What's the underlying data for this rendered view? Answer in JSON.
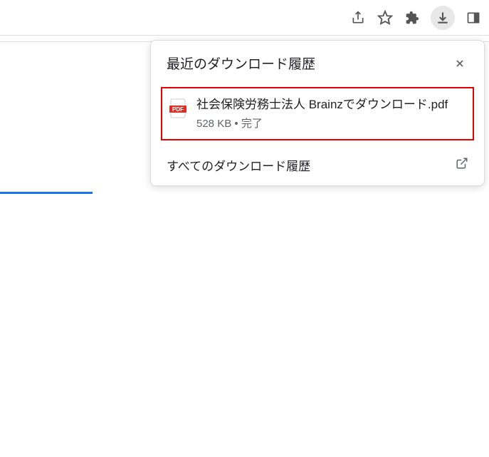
{
  "toolbar": {
    "icons": {
      "share": "share-icon",
      "star": "star-icon",
      "extensions": "puzzle-icon",
      "downloads": "download-icon",
      "panel": "sidepanel-icon"
    }
  },
  "dropdown": {
    "title": "最近のダウンロード履歴",
    "close_label": "閉じる",
    "item": {
      "filename": "社会保険労務士法人 Brainzでダウンロード.pdf",
      "size": "528 KB",
      "separator": " • ",
      "status": "完了"
    },
    "all_downloads_label": "すべてのダウンロード履歴"
  }
}
